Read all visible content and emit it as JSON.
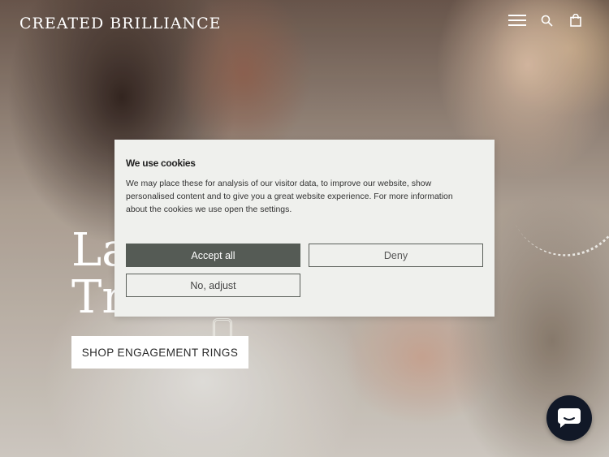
{
  "header": {
    "logo": "CREATED BRILLIANCE",
    "icons": [
      "menu-icon",
      "search-icon",
      "bag-icon"
    ]
  },
  "hero": {
    "headline_partial": "La\nTr",
    "cta_label": "SHOP ENGAGEMENT RINGS"
  },
  "cookie_modal": {
    "title": "We use cookies",
    "body": "We may place these for analysis of our visitor data, to improve our website, show personalised content and to give you a great website experience. For more information about the cookies we use open the settings.",
    "accept_label": "Accept all",
    "deny_label": "Deny",
    "adjust_label": "No, adjust"
  },
  "chat": {
    "icon": "chat-icon"
  },
  "colors": {
    "accept_bg": "#555b55",
    "modal_bg": "#eff0ed",
    "chat_bg": "#111827"
  }
}
